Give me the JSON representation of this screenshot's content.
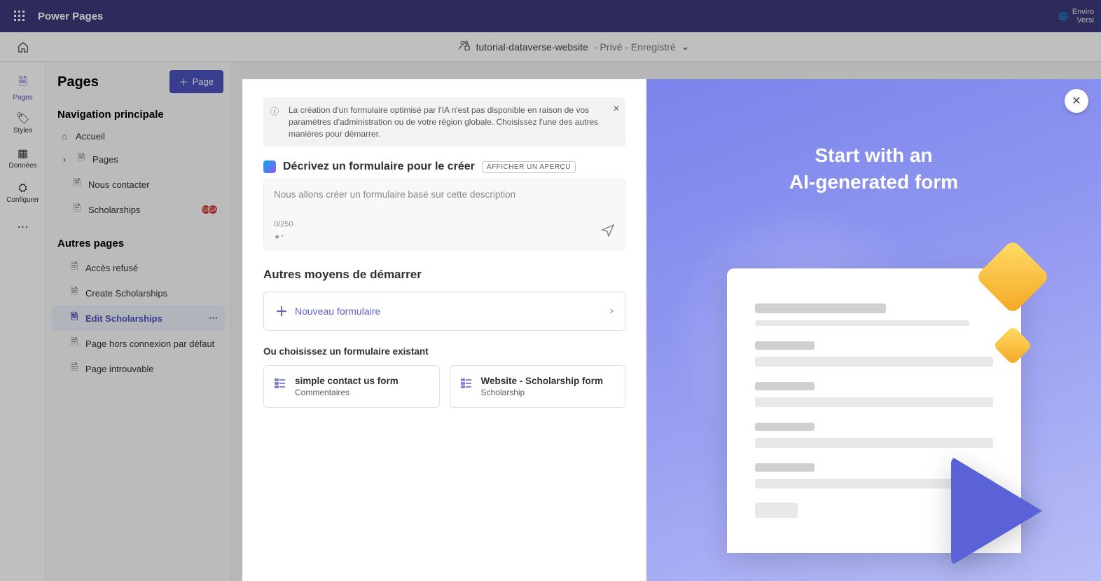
{
  "topbar": {
    "brand": "Power Pages",
    "env_line1": "Enviro",
    "env_line2": "Versi"
  },
  "header": {
    "site_name": "tutorial-dataverse-website",
    "site_status": "- Privé - Enregistré"
  },
  "rail": {
    "pages": "Pages",
    "styles": "Styles",
    "data": "Données",
    "config": "Configurer",
    "more": "⋯"
  },
  "pages_panel": {
    "title": "Pages",
    "add_button": "Page",
    "nav_heading": "Navigation principale",
    "other_heading": "Autres pages",
    "main_nav": [
      {
        "label": "Accueil",
        "icon": "⌂"
      },
      {
        "label": "Pages",
        "icon": "🗎",
        "chevron": true
      },
      {
        "label": "Nous contacter",
        "icon": "🗎"
      },
      {
        "label": "Scholarships",
        "icon": "🗎",
        "badges": true
      }
    ],
    "other_pages": [
      {
        "label": "Accès refusé"
      },
      {
        "label": "Create Scholarships"
      },
      {
        "label": "Edit Scholarships",
        "active": true
      },
      {
        "label": "Page hors connexion par défaut"
      },
      {
        "label": "Page introuvable"
      }
    ]
  },
  "modal": {
    "alert": "La création d'un formulaire optimisé par l'IA n'est pas disponible en raison de vos paramètres d'administration ou de votre région globale. Choisissez l'une des autres manières pour démarrer.",
    "describe_title": "Décrivez un formulaire pour le créer",
    "preview_badge": "AFFICHER UN APERÇU",
    "placeholder": "Nous allons créer un formulaire basé sur cette description",
    "counter": "0/250",
    "other_means": "Autres moyens de démarrer",
    "new_form": "Nouveau formulaire",
    "choose_existing": "Ou choisissez un formulaire existant",
    "forms": [
      {
        "title": "simple contact us form",
        "subtitle": "Commentaires"
      },
      {
        "title": "Website - Scholarship form",
        "subtitle": "Scholarship"
      }
    ],
    "hero_line1": "Start with an",
    "hero_line2": "AI-generated form"
  }
}
